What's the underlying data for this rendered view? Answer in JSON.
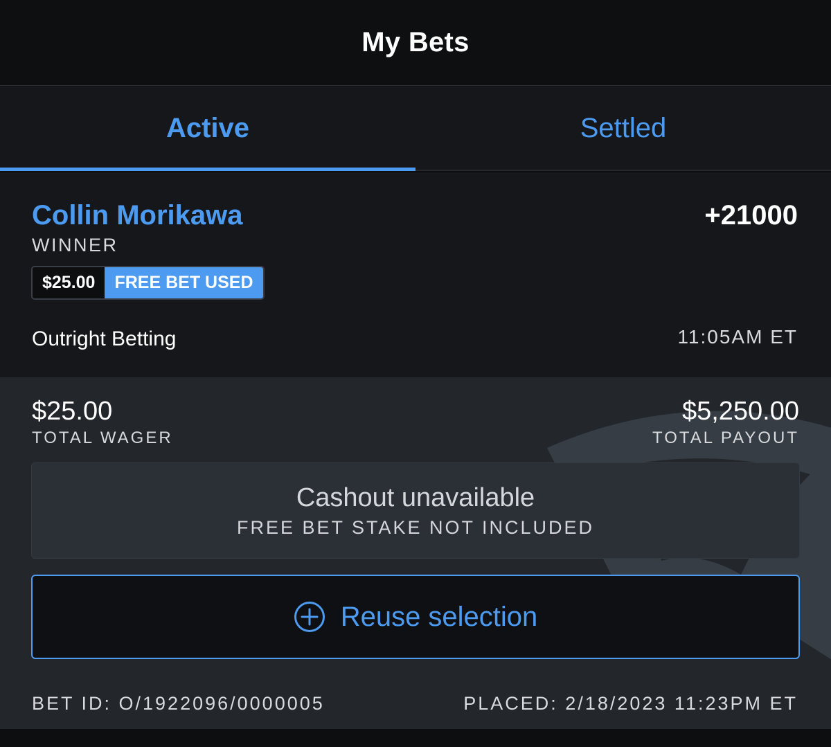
{
  "header": {
    "title": "My Bets"
  },
  "tabs": [
    {
      "label": "Active",
      "active": true
    },
    {
      "label": "Settled",
      "active": false
    }
  ],
  "bet": {
    "selection": "Collin Morikawa",
    "odds": "+21000",
    "market": "WINNER",
    "badge": {
      "amount": "$25.00",
      "label": "FREE BET USED"
    },
    "bet_type": "Outright Betting",
    "time": "11:05AM ET",
    "total_wager": {
      "value": "$25.00",
      "label": "TOTAL WAGER"
    },
    "total_payout": {
      "value": "$5,250.00",
      "label": "TOTAL PAYOUT"
    },
    "cashout": {
      "title": "Cashout unavailable",
      "subtitle": "FREE BET STAKE NOT INCLUDED"
    },
    "reuse": {
      "label": "Reuse selection",
      "icon": "plus-circle-icon"
    },
    "bet_id": "BET ID: O/1922096/0000005",
    "placed": "PLACED: 2/18/2023 11:23PM ET"
  },
  "colors": {
    "accent": "#4d9bf0",
    "background": "#0d0e10",
    "card": "#15171b",
    "card_bottom": "#23272b"
  }
}
